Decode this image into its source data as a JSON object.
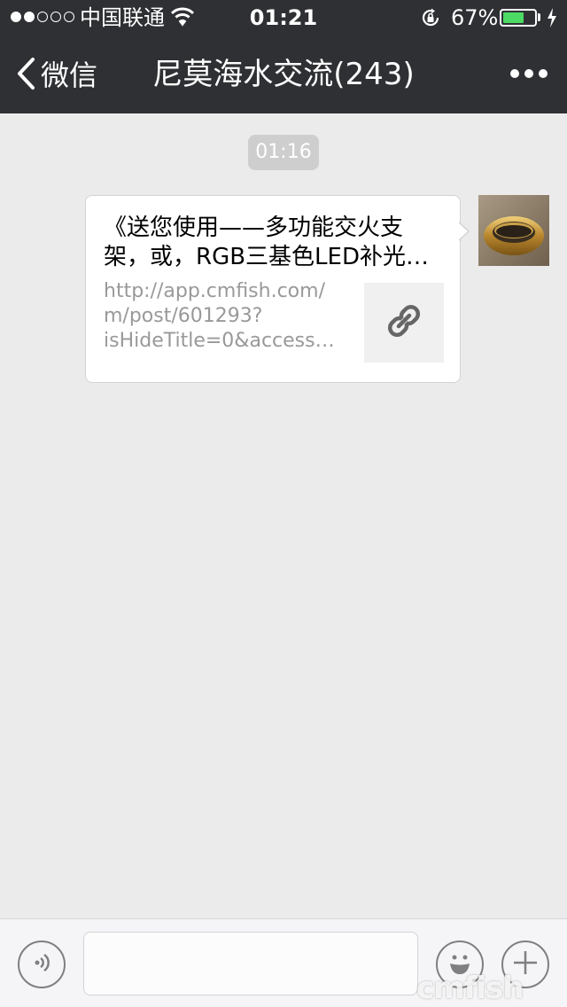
{
  "status_bar": {
    "carrier": "中国联通",
    "time": "01:21",
    "battery_percent_label": "67%",
    "battery_level": 0.67,
    "battery_color": "#4cd964",
    "signal_bars_filled": 2,
    "signal_bars_total": 5
  },
  "nav": {
    "back_label": "微信",
    "title": "尼莫海水交流(243)"
  },
  "chat": {
    "timestamp": "01:16",
    "message": {
      "title_lines": [
        "《送您使用——多功能交火支",
        "架，或，RGB三基色LED补光…"
      ],
      "url_lines": [
        "http://app.cmfish.com/",
        "m/post/601293?",
        "isHideTitle=0&access…"
      ],
      "thumb_icon": "link-icon"
    }
  },
  "input_bar": {
    "voice_icon": "voice-icon",
    "emoji_icon": "emoji-icon",
    "plus_icon": "plus-icon"
  },
  "watermark": "cmfish",
  "colors": {
    "header_bg": "#2f3034",
    "chat_bg": "#ebebeb",
    "input_bar_bg": "#f5f5f7"
  }
}
